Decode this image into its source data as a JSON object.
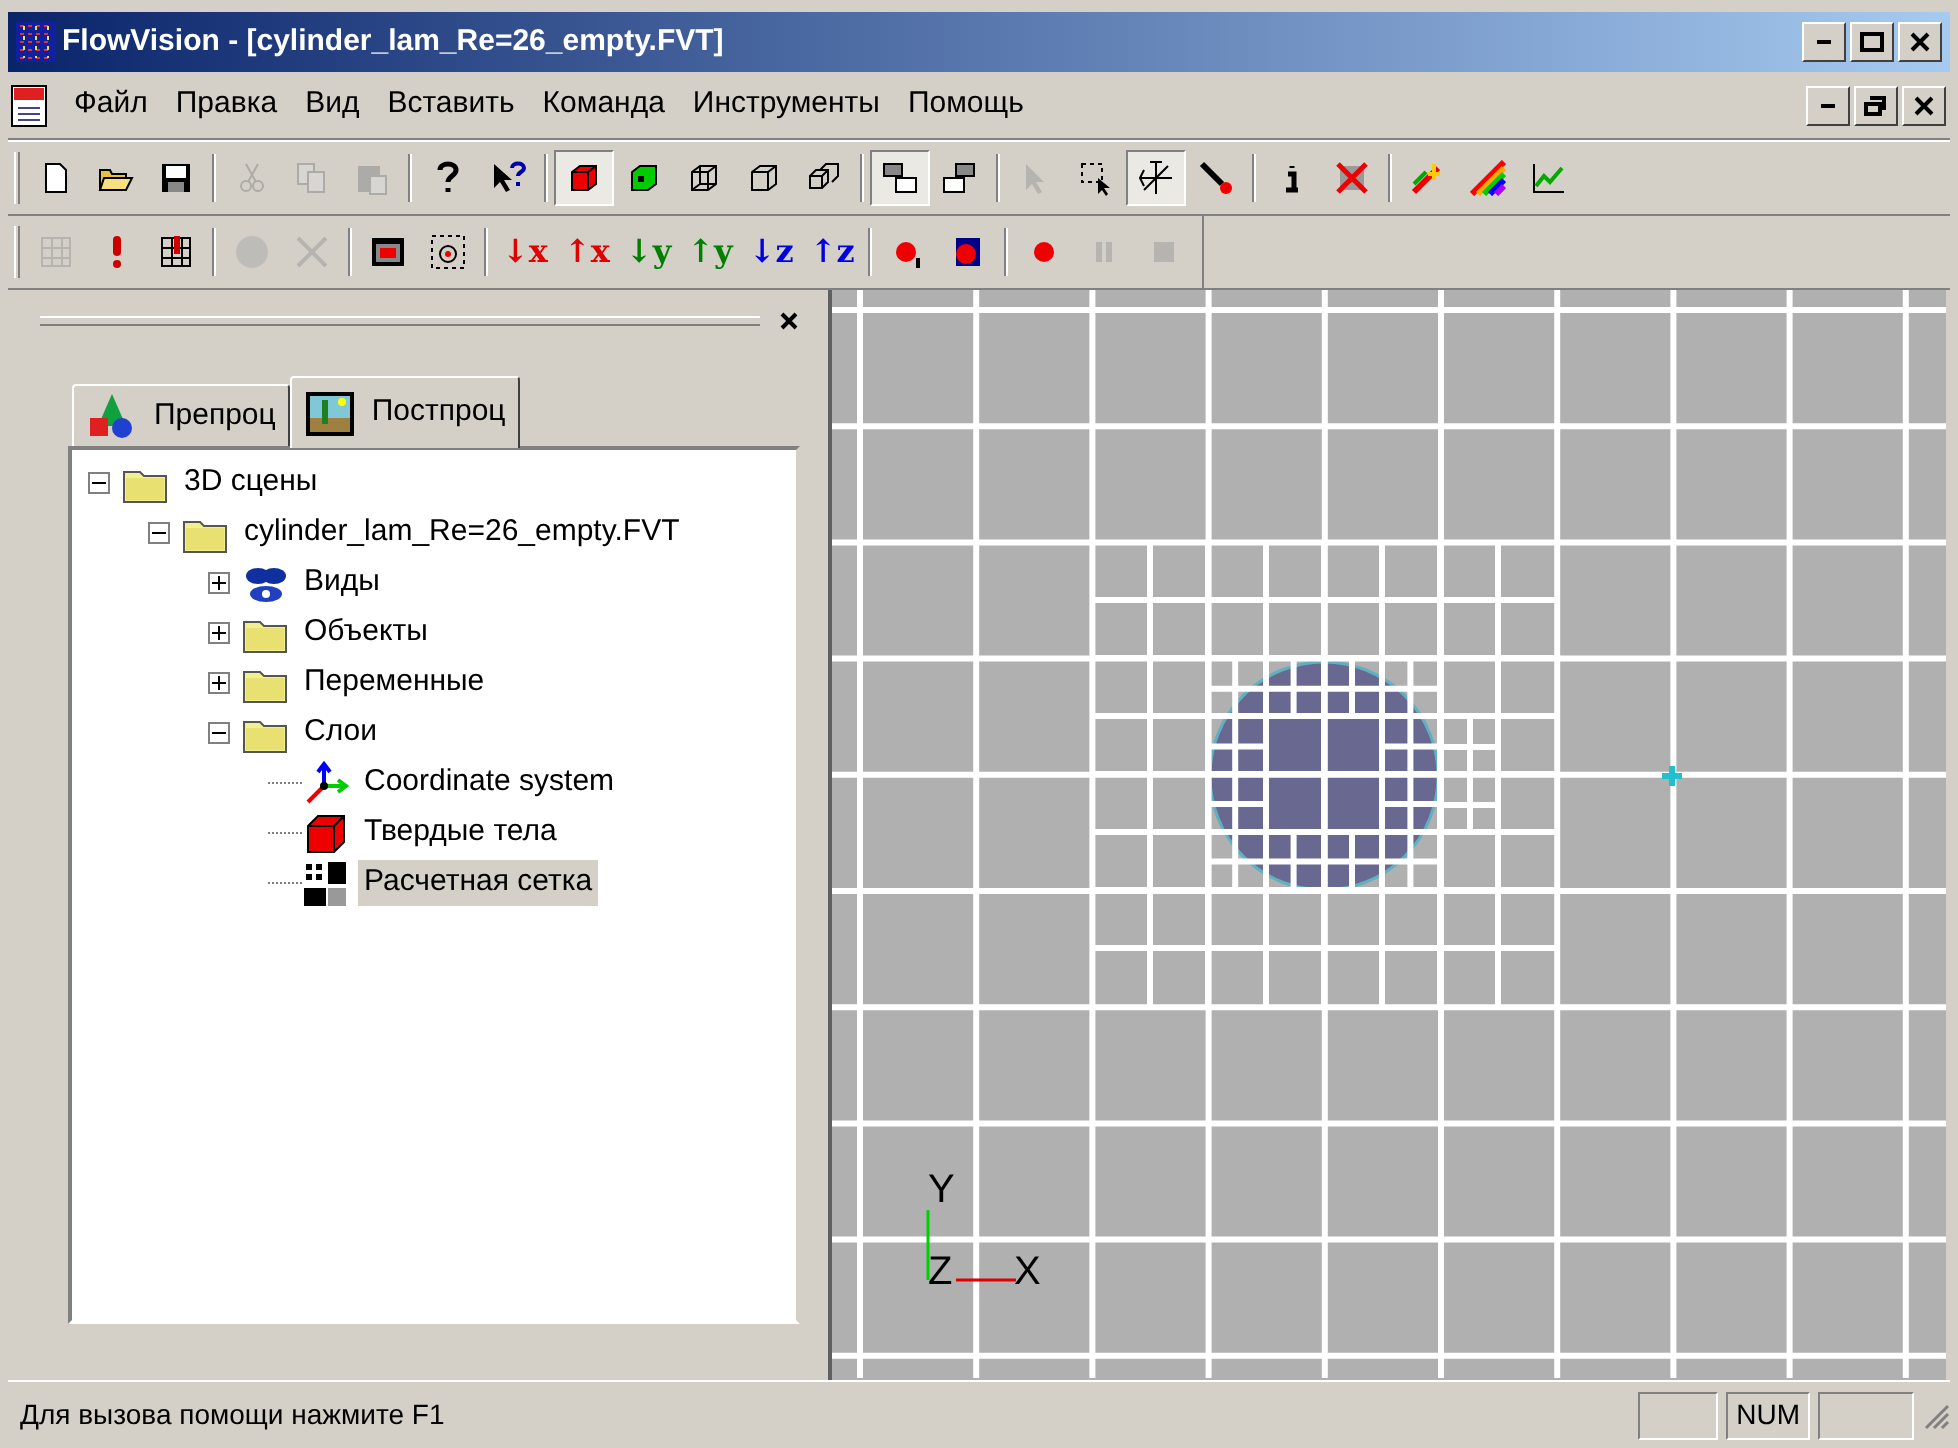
{
  "window": {
    "title": "FlowVision - [cylinder_lam_Re=26_empty.FVT]"
  },
  "menu": [
    {
      "label": "Файл"
    },
    {
      "label": "Правка"
    },
    {
      "label": "Вид"
    },
    {
      "label": "Вставить"
    },
    {
      "label": "Команда"
    },
    {
      "label": "Инструменты"
    },
    {
      "label": "Помощь"
    }
  ],
  "toolbar_1": [
    {
      "kind": "new",
      "pressed": false,
      "disabled": false
    },
    {
      "kind": "open",
      "pressed": false,
      "disabled": false
    },
    {
      "kind": "save",
      "pressed": false,
      "disabled": false
    },
    {
      "kind": "separator"
    },
    {
      "kind": "cut",
      "pressed": false,
      "disabled": true
    },
    {
      "kind": "copy",
      "pressed": false,
      "disabled": true
    },
    {
      "kind": "paste",
      "pressed": false,
      "disabled": true
    },
    {
      "kind": "separator"
    },
    {
      "kind": "help",
      "pressed": false,
      "disabled": false
    },
    {
      "kind": "context-help",
      "pressed": false,
      "disabled": false
    },
    {
      "kind": "separator"
    },
    {
      "kind": "solid-cube",
      "pressed": true,
      "disabled": false
    },
    {
      "kind": "green-cube",
      "pressed": false,
      "disabled": false
    },
    {
      "kind": "wire-cube",
      "pressed": false,
      "disabled": false
    },
    {
      "kind": "outline-cube",
      "pressed": false,
      "disabled": false
    },
    {
      "kind": "cube-pair",
      "pressed": false,
      "disabled": false
    },
    {
      "kind": "separator"
    },
    {
      "kind": "layout-down",
      "pressed": true,
      "disabled": false
    },
    {
      "kind": "layout-up",
      "pressed": false,
      "disabled": false
    },
    {
      "kind": "separator"
    },
    {
      "kind": "pointer",
      "pressed": false,
      "disabled": true
    },
    {
      "kind": "select-area",
      "pressed": false,
      "disabled": false
    },
    {
      "kind": "move-axes",
      "pressed": true,
      "disabled": false
    },
    {
      "kind": "probe",
      "pressed": false,
      "disabled": false
    },
    {
      "kind": "separator"
    },
    {
      "kind": "info",
      "pressed": false,
      "disabled": false
    },
    {
      "kind": "cross-out",
      "pressed": false,
      "disabled": false
    },
    {
      "kind": "separator"
    },
    {
      "kind": "spark",
      "pressed": false,
      "disabled": false
    },
    {
      "kind": "rainbow",
      "pressed": false,
      "disabled": false
    },
    {
      "kind": "chart",
      "pressed": false,
      "disabled": false
    }
  ],
  "toolbar_2": [
    {
      "kind": "grid",
      "disabled": true
    },
    {
      "kind": "exclamation",
      "disabled": false
    },
    {
      "kind": "grid-mark",
      "disabled": false
    },
    {
      "kind": "separator"
    },
    {
      "kind": "stop-sign",
      "disabled": true
    },
    {
      "kind": "cross",
      "disabled": true
    },
    {
      "kind": "separator"
    },
    {
      "kind": "window",
      "disabled": false
    },
    {
      "kind": "target",
      "disabled": false
    },
    {
      "kind": "separator"
    },
    {
      "kind": "axis",
      "label": "↓x",
      "color": "#e00000",
      "disabled": false
    },
    {
      "kind": "axis",
      "label": "↑x",
      "color": "#e00000",
      "disabled": false
    },
    {
      "kind": "axis",
      "label": "↓y",
      "color": "#008000",
      "disabled": false
    },
    {
      "kind": "axis",
      "label": "↑y",
      "color": "#008000",
      "disabled": false
    },
    {
      "kind": "axis",
      "label": "↓z",
      "color": "#0000e0",
      "disabled": false
    },
    {
      "kind": "axis",
      "label": "↑z",
      "color": "#0000e0",
      "disabled": false
    },
    {
      "kind": "separator"
    },
    {
      "kind": "record-one",
      "disabled": false
    },
    {
      "kind": "record-frame",
      "disabled": false
    },
    {
      "kind": "separator"
    },
    {
      "kind": "record",
      "disabled": false
    },
    {
      "kind": "pause",
      "disabled": true
    },
    {
      "kind": "stop",
      "disabled": true
    }
  ],
  "panel": {
    "tabs": [
      {
        "label": "Препроц",
        "kind": "preprocessor",
        "selected": false
      },
      {
        "label": "Постпроц",
        "kind": "postprocessor",
        "selected": true
      }
    ],
    "tree": [
      {
        "label": "3D сцены",
        "kind": "folder",
        "expanded": true,
        "selected": false,
        "children": [
          {
            "label": "cylinder_lam_Re=26_empty.FVT",
            "kind": "folder",
            "expanded": true,
            "selected": false,
            "children": [
              {
                "label": "Виды",
                "kind": "views",
                "expanded": false,
                "selected": false
              },
              {
                "label": "Объекты",
                "kind": "folder",
                "expanded": false,
                "selected": false
              },
              {
                "label": "Переменные",
                "kind": "folder",
                "expanded": false,
                "selected": false
              },
              {
                "label": "Слои",
                "kind": "folder",
                "expanded": true,
                "selected": false,
                "children": [
                  {
                    "label": "Coordinate system",
                    "kind": "axes",
                    "selected": false
                  },
                  {
                    "label": "Твердые тела",
                    "kind": "solid",
                    "selected": false
                  },
                  {
                    "label": "Расчетная сетка",
                    "kind": "grid",
                    "selected": true
                  }
                ]
              }
            ]
          }
        ]
      }
    ]
  },
  "viewport": {
    "axes": {
      "y": "Y",
      "z": "Z",
      "x": "X"
    }
  },
  "status_bar": {
    "text": "Для вызова помощи нажмите F1",
    "indicators": [
      "NUM"
    ]
  }
}
